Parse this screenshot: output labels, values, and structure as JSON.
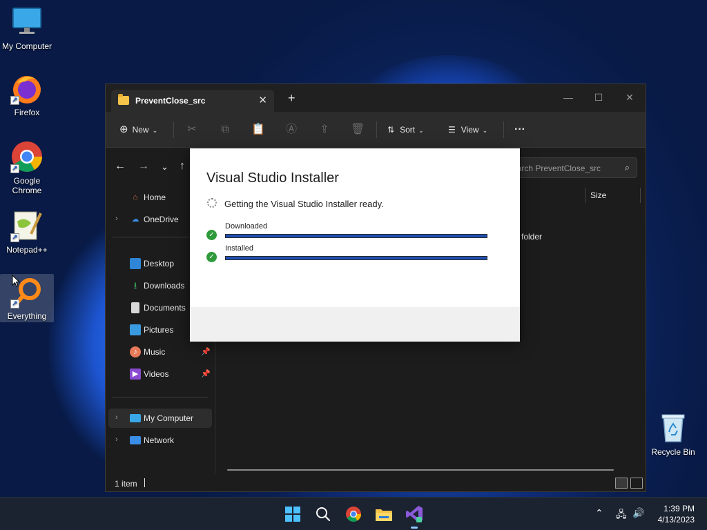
{
  "desktop": {
    "icons": [
      {
        "label": "My Computer"
      },
      {
        "label": "Firefox"
      },
      {
        "label": "Google Chrome"
      },
      {
        "label": "Notepad++"
      },
      {
        "label": "Everything"
      },
      {
        "label": "Recycle Bin"
      }
    ]
  },
  "explorer": {
    "tab_title": "PreventClose_src",
    "new_tab": "+",
    "toolbar": {
      "new_label": "New",
      "sort_label": "Sort",
      "view_label": "View",
      "more_label": "···"
    },
    "search_placeholder": "Search PreventClose_src",
    "sidebar": {
      "home": "Home",
      "onedrive": "OneDrive",
      "desktop": "Desktop",
      "downloads": "Downloads",
      "documents": "Documents",
      "pictures": "Pictures",
      "music": "Music",
      "videos": "Videos",
      "my_computer": "My Computer",
      "network": "Network"
    },
    "columns": {
      "type_partial": "e",
      "size": "Size"
    },
    "row_partial": "folder",
    "status_count": "1 item"
  },
  "installer": {
    "title": "Visual Studio Installer",
    "status": "Getting the Visual Studio Installer ready.",
    "steps": [
      {
        "label": "Downloaded",
        "progress": 1.0
      },
      {
        "label": "Installed",
        "progress": 1.0
      }
    ]
  },
  "taskbar": {
    "time": "1:39 PM",
    "date": "4/13/2023"
  },
  "colors": {
    "progress_fill": "#1f4fb0",
    "check_green": "#2e9a3a",
    "window_bg": "#1c1c1c"
  }
}
